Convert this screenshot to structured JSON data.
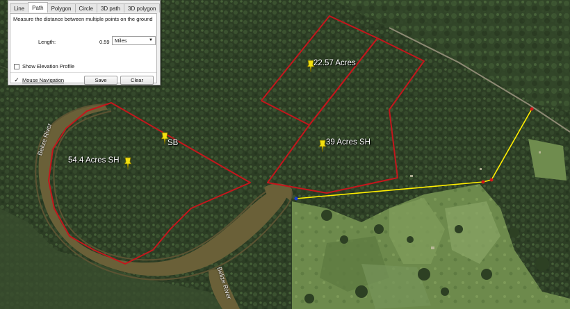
{
  "ruler": {
    "tabs": [
      {
        "label": "Line",
        "active": false
      },
      {
        "label": "Path",
        "active": true
      },
      {
        "label": "Polygon",
        "active": false
      },
      {
        "label": "Circle",
        "active": false
      },
      {
        "label": "3D path",
        "active": false
      },
      {
        "label": "3D polygon",
        "active": false
      }
    ],
    "description": "Measure the distance between multiple points on the ground",
    "length_label": "Length:",
    "length_value": "0.59",
    "unit_selected": "Miles",
    "show_elevation_label": "Show Elevation Profile",
    "show_elevation_checked": false,
    "mouse_nav_label": "Mouse Navigation",
    "mouse_nav_checked": true,
    "save_label": "Save",
    "clear_label": "Clear"
  },
  "placemarks": {
    "acres_22": "22.57 Acres",
    "acres_39": "39 Acres SH",
    "sb": "SB",
    "acres_54": "54.4 Acres SH"
  },
  "river_labels": {
    "left": "Belize River",
    "bottom": "Belize River"
  },
  "colors": {
    "boundary": "#c4161c",
    "path": "#ffee00",
    "pin": "#f2e010"
  }
}
